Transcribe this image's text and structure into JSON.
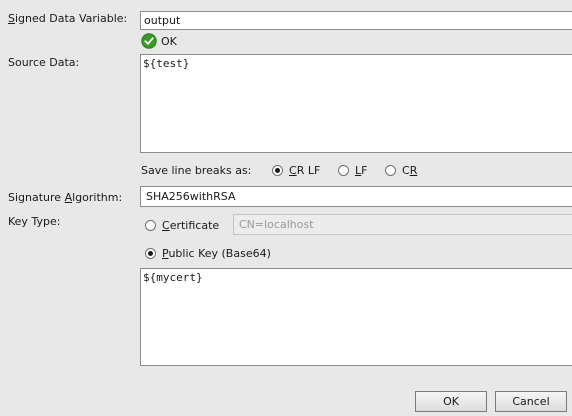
{
  "signed_data_variable": {
    "label_pre": "",
    "label_mn": "S",
    "label_post": "igned Data Variable:",
    "value": "output",
    "status_text": "OK"
  },
  "source_data": {
    "label": "Source Data:",
    "value": "${test}"
  },
  "line_breaks": {
    "label": "Save line breaks as:",
    "options": [
      {
        "pre": "",
        "mn": "C",
        "post": "R LF",
        "checked": true
      },
      {
        "pre": "",
        "mn": "L",
        "post": "F",
        "checked": false
      },
      {
        "pre": "C",
        "mn": "R",
        "post": "",
        "checked": false
      }
    ]
  },
  "signature_algorithm": {
    "label_pre": "Signature ",
    "label_mn": "A",
    "label_post": "lgorithm:",
    "value": "SHA256withRSA"
  },
  "key_type": {
    "label": "Key Type:",
    "certificate": {
      "pre": "",
      "mn": "C",
      "post": "ertificate",
      "checked": false,
      "value": "CN=localhost"
    },
    "public_key": {
      "pre": "",
      "mn": "P",
      "post": "ublic Key (Base64)",
      "checked": true,
      "value": "${mycert}"
    }
  },
  "buttons": {
    "ok": "OK",
    "cancel": "Cancel"
  },
  "colors": {
    "background": "#e8e8e8",
    "ok_icon": "#3a9a2a"
  }
}
